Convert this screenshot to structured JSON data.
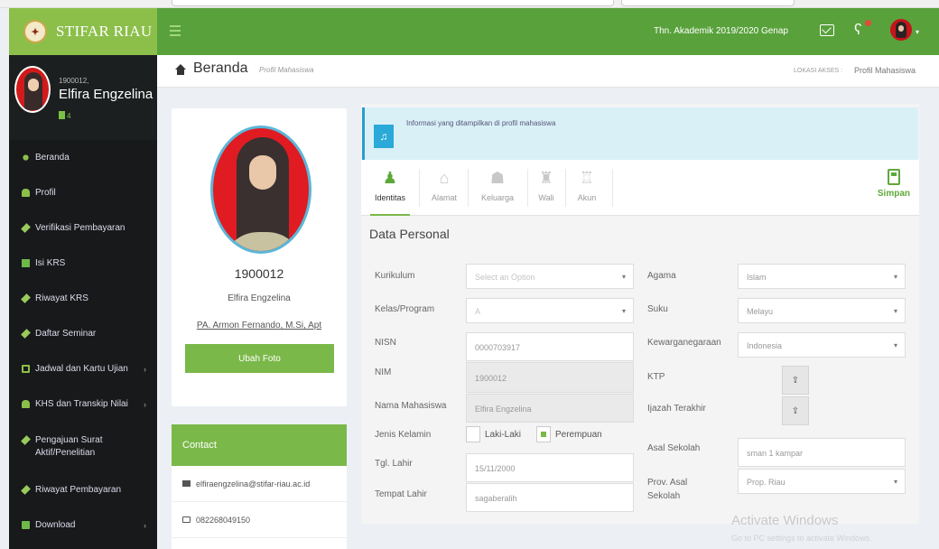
{
  "header": {
    "brand": "STIFAR RIAU",
    "academic_year": "Thn. Akademik 2019/2020 Genap",
    "colors": {
      "brand_green": "#8cbf4a",
      "navbar_green": "#59a13b",
      "sidebar_dark": "#17191a",
      "info_blue": "#2ba9d9"
    }
  },
  "sidebar": {
    "user": {
      "id": "1900012,",
      "name": "Elfira Engzelina",
      "status": "4"
    },
    "items": [
      {
        "label": "Beranda",
        "icon": "dot-icon"
      },
      {
        "label": "Profil",
        "icon": "user-icon"
      },
      {
        "label": "Verifikasi Pembayaran",
        "icon": "pencil-icon"
      },
      {
        "label": "Isi KRS",
        "icon": "book-icon"
      },
      {
        "label": "Riwayat KRS",
        "icon": "pencil-icon"
      },
      {
        "label": "Daftar Seminar",
        "icon": "pencil-icon"
      },
      {
        "label": "Jadwal dan Kartu Ujian",
        "icon": "calendar-icon",
        "chevron": "›"
      },
      {
        "label": "KHS dan Transkip Nilai",
        "icon": "users-icon",
        "chevron": "›"
      },
      {
        "label": "Pengajuan Surat Aktif/Penelitian",
        "icon": "pencil-icon"
      },
      {
        "label": "Riwayat Pembayaran",
        "icon": "pencil-icon"
      },
      {
        "label": "Download",
        "icon": "download-icon",
        "chevron": "›"
      }
    ]
  },
  "content_header": {
    "title": "Beranda",
    "subtitle": "Profil Mahasiswa",
    "location_label": "LOKASI AKSES :",
    "location_value": "Profil Mahasiswa"
  },
  "profile": {
    "id": "1900012",
    "name": "Elfira Engzelina",
    "advisor": "PA. Armon Fernando, M.Si, Apt",
    "change_photo_label": "Ubah Foto"
  },
  "contact": {
    "title": "Contact",
    "email": "elfiraengzelina@stifar-riau.ac.id",
    "phone": "082268049150"
  },
  "info_message": "Informasi yang ditampilkan di profil mahasiswa",
  "tabs": [
    {
      "label": "Identitas",
      "icon": "user-icon",
      "active": true
    },
    {
      "label": "Alamat",
      "icon": "home-icon",
      "active": false
    },
    {
      "label": "Keluarga",
      "icon": "users-icon",
      "active": false
    },
    {
      "label": "Wali",
      "icon": "user-lock-icon",
      "active": false
    },
    {
      "label": "Akun",
      "icon": "unlock-icon",
      "active": false
    }
  ],
  "save_label": "Simpan",
  "form": {
    "section_title": "Data Personal",
    "kurikulum": {
      "label": "Kurikulum",
      "placeholder": "Select an Option"
    },
    "kelas": {
      "label": "Kelas/Program",
      "value": "A"
    },
    "nisn": {
      "label": "NISN",
      "value": "0000703917"
    },
    "nim": {
      "label": "NIM",
      "value": "1900012"
    },
    "nama": {
      "label": "Nama Mahasiswa",
      "value": "Elfira Engzelina"
    },
    "jenis_kelamin": {
      "label": "Jenis Kelamin",
      "option_male": "Laki-Laki",
      "option_female": "Perempuan",
      "selected": "Perempuan"
    },
    "tgl_lahir": {
      "label": "Tgl. Lahir",
      "value": "15/11/2000"
    },
    "tempat_lahir": {
      "label": "Tempat Lahir",
      "value": "sagaberalih"
    },
    "agama": {
      "label": "Agama",
      "value": "Islam"
    },
    "suku": {
      "label": "Suku",
      "value": "Melayu"
    },
    "kewarganegaraan": {
      "label": "Kewarganegaraan",
      "value": "Indonesia"
    },
    "ktp": {
      "label": "KTP"
    },
    "ijazah": {
      "label": "Ijazah Terakhir"
    },
    "asal_sekolah": {
      "label": "Asal Sekolah",
      "value": "sman 1 kampar"
    },
    "prov_sekolah": {
      "label": "Prov. Asal Sekolah",
      "value": "Prop. Riau"
    }
  },
  "watermark": {
    "title": "Activate Windows",
    "subtitle": "Go to PC settings to activate Windows."
  }
}
